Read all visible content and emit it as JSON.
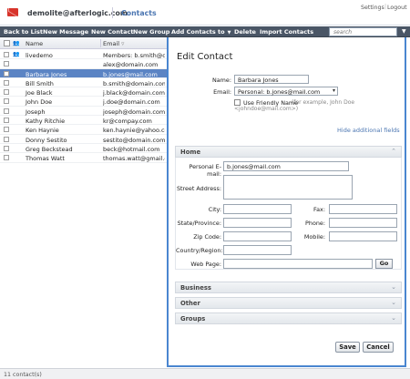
{
  "header": {
    "account": "demolite@afterlogic.com",
    "active_screen": "Contacts",
    "settings_label": "Settings",
    "separator": "|",
    "logout_label": "Logout"
  },
  "toolbar": {
    "back_label": "Back to List",
    "new_message_label": "New Message",
    "new_contact_label": "New Contact",
    "new_group_label": "New Group",
    "add_contacts_label": "Add Contacts to",
    "delete_label": "Delete",
    "import_label": "Import Contacts",
    "search_placeholder": "search"
  },
  "list": {
    "col_name": "Name",
    "col_email": "Email",
    "rows": [
      {
        "name": "livedemo",
        "email": "Members: b.smith@doma",
        "group": true,
        "selected": false
      },
      {
        "name": "",
        "email": "alex@domain.com",
        "group": false,
        "selected": false
      },
      {
        "name": "Barbara Jones",
        "email": "b.jones@mail.com",
        "group": false,
        "selected": true
      },
      {
        "name": "Bill Smith",
        "email": "b.smith@domain.com",
        "group": false,
        "selected": false
      },
      {
        "name": "Joe Black",
        "email": "j.black@domain.com",
        "group": false,
        "selected": false
      },
      {
        "name": "John Doe",
        "email": "j.doe@domain.com",
        "group": false,
        "selected": false
      },
      {
        "name": "Joseph",
        "email": "joseph@domain.com",
        "group": false,
        "selected": false
      },
      {
        "name": "Kathy Ritchie",
        "email": "kr@compay.com",
        "group": false,
        "selected": false
      },
      {
        "name": "Ken Haynie",
        "email": "ken.haynie@yahoo.com",
        "group": false,
        "selected": false
      },
      {
        "name": "Donny Sestito",
        "email": "sestito@domain.com",
        "group": false,
        "selected": false
      },
      {
        "name": "Greg Beckstead",
        "email": "beck@hotmail.com",
        "group": false,
        "selected": false
      },
      {
        "name": "Thomas Watt",
        "email": "thomas.watt@gmail.com",
        "group": false,
        "selected": false
      }
    ]
  },
  "status": {
    "count_text": "11 contact(s)"
  },
  "edit": {
    "title": "Edit Contact",
    "name_label": "Name:",
    "name_value": "Barbara Jones",
    "email_label": "Email:",
    "email_value": "Personal: b.jones@mail.com",
    "friendly_label": "Use Friendly Name",
    "friendly_note_1": "(for example, John Doe",
    "friendly_note_2": "<johndoe@mail.com>)",
    "hide_fields_link": "Hide additional fields",
    "home_section": "Home",
    "personal_email_label": "Personal E-mail:",
    "personal_email_value": "b.jones@mail.com",
    "street_label": "Street Address:",
    "city_label": "City:",
    "fax_label": "Fax:",
    "state_label": "State/Province:",
    "phone_label": "Phone:",
    "zip_label": "Zip Code:",
    "mobile_label": "Mobile:",
    "country_label": "Country/Region:",
    "webpage_label": "Web Page:",
    "go_label": "Go",
    "business_section": "Business",
    "other_section": "Other",
    "groups_section": "Groups",
    "save_label": "Save",
    "cancel_label": "Cancel"
  },
  "colors": {
    "accent": "#4a86d0",
    "toolbar": "#4a5666",
    "selected_row": "#5b84c4",
    "brand_red": "#d8342b"
  }
}
